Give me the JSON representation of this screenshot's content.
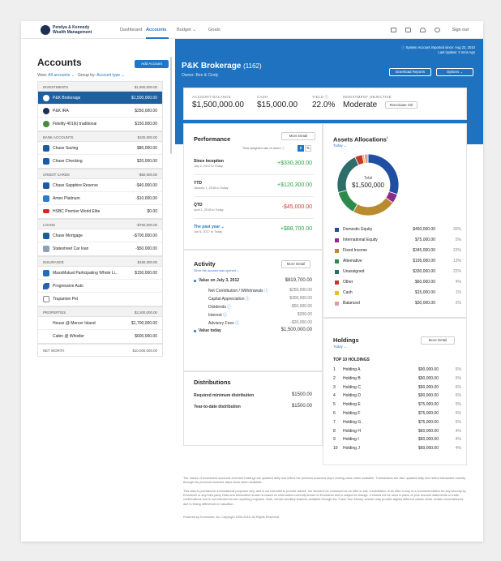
{
  "nav": {
    "logo_line1": "Pendya & Kennedy",
    "logo_line2": "Wealth Management",
    "links": [
      "Dashboard",
      "Accounts",
      "Budget",
      "Goals"
    ],
    "active": "Accounts",
    "sign_out": "Sign out"
  },
  "sidebar": {
    "title": "Accounts",
    "add_button": "Add Account",
    "view_label": "View:",
    "view_value": "All accounts",
    "group_label": "Group by:",
    "group_value": "Account type",
    "groups": [
      {
        "name": "INVESTMENTS",
        "total": "$1,900,000.00",
        "items": [
          {
            "name": "P&K Brokerage",
            "value": "$1,500,000.00",
            "selected": true,
            "icon": "pk-logo-icon"
          },
          {
            "name": "P&K IRA",
            "value": "$250,000.00",
            "icon": "pk-logo-icon"
          },
          {
            "name": "Fidelity 401(k) traditional",
            "value": "$150,000.00",
            "icon": "fidelity-icon"
          }
        ]
      },
      {
        "name": "BANK ACCOUNTS",
        "total": "$100,000.00",
        "items": [
          {
            "name": "Chase Saving",
            "value": "$80,000.00",
            "icon": "chase-icon"
          },
          {
            "name": "Chase Checking",
            "value": "$20,000.00",
            "icon": "chase-icon"
          }
        ]
      },
      {
        "name": "CREDIT CARDS",
        "total": "-$50,000.00",
        "items": [
          {
            "name": "Chase Sapphire Reserve",
            "value": "-$40,000.00",
            "icon": "chase-icon"
          },
          {
            "name": "Amex Platinum",
            "value": "-$10,000.00",
            "icon": "amex-icon"
          },
          {
            "name": "HSBC Premier World Elite",
            "value": "$0.00",
            "icon": "hsbc-icon"
          }
        ]
      },
      {
        "name": "LOANS",
        "total": "-$750,000.00",
        "items": [
          {
            "name": "Chase Mortgage",
            "value": "-$700,000.00",
            "icon": "chase-icon"
          },
          {
            "name": "Statestreet Car loan",
            "value": "-$50,000.00",
            "icon": "bank-icon"
          }
        ]
      },
      {
        "name": "INSURANCE",
        "total": "$150,000.00",
        "items": [
          {
            "name": "MassMutual Participating Whole Li...",
            "value": "$150,000.00",
            "icon": "massmutual-icon"
          },
          {
            "name": "Progressive Auto",
            "value": "",
            "icon": "progressive-icon"
          },
          {
            "name": "Trupanion Pet",
            "value": "",
            "icon": "trupanion-icon"
          }
        ]
      },
      {
        "name": "PROPERTIES",
        "total": "$2,300,000.00",
        "items": [
          {
            "name": "House @ Mercer Island",
            "value": "$1,700,000.00",
            "icon": ""
          },
          {
            "name": "Cabin @ Whistler",
            "value": "$600,000.00",
            "icon": ""
          }
        ]
      }
    ],
    "net_worth_label": "NET WORTH",
    "net_worth_value": "$10,000,000.00"
  },
  "header": {
    "title": "P&K Brokerage",
    "count": "(1162)",
    "owner": "Owner: Ben & Cindy",
    "sync_line1": "System Account imported since: Aug 23, 2010",
    "sync_line2": "Last Update: 3 mins Ago",
    "download_btn": "Download Reports",
    "options_btn": "Options"
  },
  "summary": {
    "balance_label": "ACCOUNT BALANCE",
    "balance": "$1,500,000.00",
    "cash_label": "CASH",
    "cash": "$15,000.00",
    "yield_label": "YIELD",
    "yield": "22.0%",
    "objective_label": "INVESTMENT OBJECTIVE",
    "objective": "Moderate",
    "rebalance_btn": "Reevaluate risk"
  },
  "performance": {
    "title": "Performance",
    "more_btn": "More Detail",
    "rate_label": "Time-weighted rate of return",
    "toggle_dollar": "$",
    "toggle_pct": "%",
    "rows": [
      {
        "label": "Since Inception",
        "sub": "July 3, 2012 to Today",
        "value": "+$330,300.00",
        "sign": "pos"
      },
      {
        "label": "YTD",
        "sub": "January 1, 2018 to Today",
        "value": "+$120,300.00",
        "sign": "pos"
      },
      {
        "label": "QTD",
        "sub": "April 1, 2018 to Today",
        "value": "-$45,000.00",
        "sign": "neg"
      },
      {
        "label": "The past year",
        "sub": "Jun 8, 2017 to Today",
        "value": "+$88,700.00",
        "sign": "pos"
      }
    ]
  },
  "activity": {
    "title": "Activity",
    "sub": "Since the account was opened",
    "more_btn": "More Detail",
    "start_label": "Value on July 3, 2012",
    "start_value": "$819,700.00",
    "items": [
      {
        "label": "Net Contribution / Withdrawals",
        "value": "$250,000.00"
      },
      {
        "label": "Capital Appreciation",
        "value": "$300,000.00"
      },
      {
        "label": "Dividends",
        "value": "-$50,000.00"
      },
      {
        "label": "Interest",
        "value": "$300.00"
      },
      {
        "label": "Advisory Fees",
        "value": "-$20,000.00"
      }
    ],
    "end_label": "Value today",
    "end_value": "$1,500,000.00"
  },
  "distributions": {
    "title": "Distributions",
    "rows": [
      {
        "label": "Required minimum distribution",
        "value": "$1500.00"
      },
      {
        "label": "Year-to-date distribution",
        "value": "$1500.00"
      }
    ]
  },
  "allocations": {
    "title": "Assets Allocations",
    "filter": "Today",
    "center_label": "Total",
    "center_value": "$1,500,000",
    "items": [
      {
        "name": "Domestic Equity",
        "value": "$450,000.00",
        "pct": "30%",
        "color": "#1e4fa3",
        "share": 30
      },
      {
        "name": "International Equity",
        "value": "$75,000.00",
        "pct": "5%",
        "color": "#8d2b8c",
        "share": 5
      },
      {
        "name": "Fixed Income",
        "value": "$345,000.00",
        "pct": "23%",
        "color": "#b98a2e",
        "share": 23
      },
      {
        "name": "Alternative",
        "value": "$195,000.00",
        "pct": "13%",
        "color": "#2c8a4a",
        "share": 13
      },
      {
        "name": "Unassigned",
        "value": "$330,000.00",
        "pct": "22%",
        "color": "#2d6e6a",
        "share": 22
      },
      {
        "name": "Other",
        "value": "$60,000.00",
        "pct": "4%",
        "color": "#c0392b",
        "share": 4
      },
      {
        "name": "Cash",
        "value": "$15,000.00",
        "pct": "1%",
        "color": "#e6c02a",
        "share": 1
      },
      {
        "name": "Balanced",
        "value": "$30,000.00",
        "pct": "2%",
        "color": "#d9a0a0",
        "share": 2
      }
    ]
  },
  "holdings": {
    "title": "Holdings",
    "filter": "Today",
    "more_btn": "More Detail",
    "subtitle": "TOP 10 HOLDINGS",
    "items": [
      {
        "n": "1",
        "name": "Holding A",
        "value": "$90,000.00",
        "pct": "6%"
      },
      {
        "n": "2",
        "name": "Holding B",
        "value": "$90,000.00",
        "pct": "6%"
      },
      {
        "n": "3",
        "name": "Holding C",
        "value": "$90,000.00",
        "pct": "6%"
      },
      {
        "n": "4",
        "name": "Holding D",
        "value": "$90,000.00",
        "pct": "6%"
      },
      {
        "n": "5",
        "name": "Holding E",
        "value": "$75,000.00",
        "pct": "5%"
      },
      {
        "n": "6",
        "name": "Holding F",
        "value": "$75,000.00",
        "pct": "5%"
      },
      {
        "n": "7",
        "name": "Holding G",
        "value": "$75,000.00",
        "pct": "5%"
      },
      {
        "n": "8",
        "name": "Holding H",
        "value": "$60,000.00",
        "pct": "4%"
      },
      {
        "n": "9",
        "name": "Holding I",
        "value": "$60,000.00",
        "pct": "4%"
      },
      {
        "n": "10",
        "name": "Holding J",
        "value": "$60,000.00",
        "pct": "4%"
      }
    ]
  },
  "footer": {
    "p1": "The values of investment accounts and their holdings are updated daily and reflect the previous business day's closing value when available. Transactions are also updated daily and reflect transaction activity through the previous business day's close when available.",
    "p2": "This data is provided for informational purposes only, and is not intended to provide advice, nor should it be construed as an offer to sell, a solicitation of an offer to buy or a recommendation for any security by Envestnet or any third party. Data and information shown is based on information currently known to Envestnet and is subject to change. It should not be used in place of your account statements or trade confirmations and is not intended for tax reporting purposes. Note, certain ancillary features available through the 'Track Your Money' section may provide slightly different values under certain circumstances due to timing differences in valuation.",
    "p3": "Powered by Envestnet, Inc. Copyright 2000-2018. All Rights Reserved."
  }
}
